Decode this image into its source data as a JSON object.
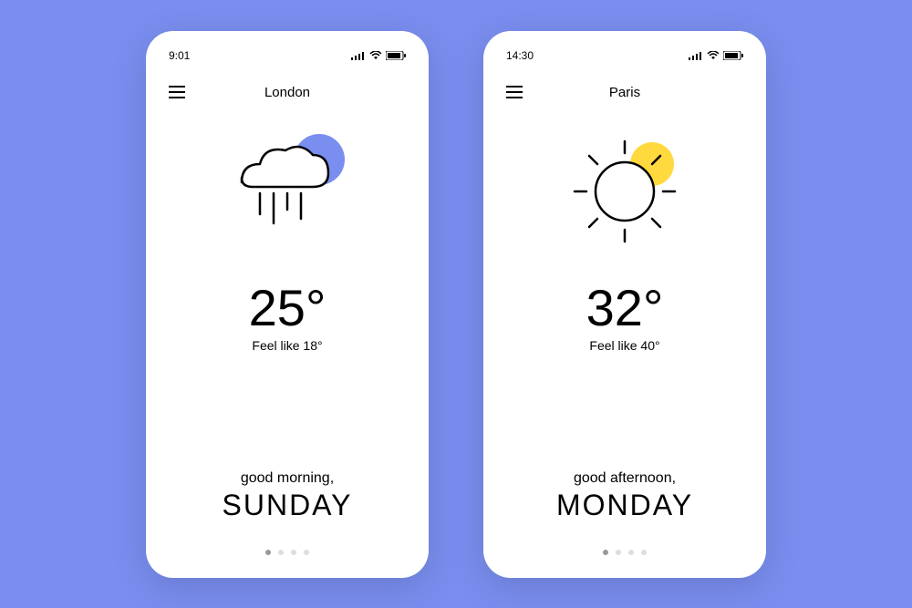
{
  "screens": [
    {
      "status_bar": {
        "time": "9:01"
      },
      "city": "London",
      "weather_icon": "cloud-rain",
      "accent_color": "#7a8ef0",
      "temperature": "25°",
      "feels_like": "Feel like 18°",
      "greeting": "good morning,",
      "day": "SUNDAY",
      "active_page": 0
    },
    {
      "status_bar": {
        "time": "14:30"
      },
      "city": "Paris",
      "weather_icon": "sun",
      "accent_color": "#ffd93d",
      "temperature": "32°",
      "feels_like": "Feel like 40°",
      "greeting": "good afternoon,",
      "day": "MONDAY",
      "active_page": 0
    }
  ],
  "page_count": 4
}
